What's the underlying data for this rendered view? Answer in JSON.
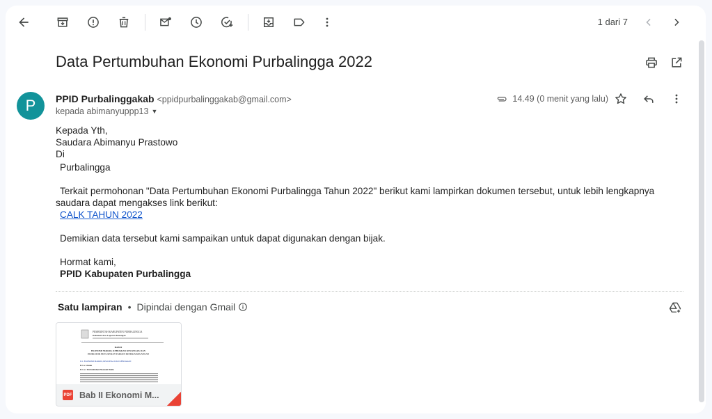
{
  "toolbar": {
    "icons": [
      "back-arrow-icon",
      "archive-icon",
      "report-spam-icon",
      "delete-icon",
      "mark-unread-icon",
      "snooze-icon",
      "add-to-tasks-icon",
      "move-to-icon",
      "label-icon",
      "more-vert-icon"
    ],
    "pager": "1 dari 7"
  },
  "email": {
    "subject": "Data Pertumbuhan Ekonomi Purbalingga 2022",
    "sender_name": "PPID Purbalinggakab",
    "sender_email": "<ppidpurbalinggakab@gmail.com>",
    "to": "kepada abimanyuppp13",
    "avatar_letter": "P",
    "avatar_color": "#12939a",
    "time": "14.49 (0 menit yang lalu)",
    "body": {
      "greeting": "Kepada Yth,",
      "recipient": "Saudara Abimanyu Prastowo",
      "di": "Di",
      "place": "Purbalingga",
      "paragraph": "Terkait permohonan \"Data Pertumbuhan Ekonomi Purbalingga Tahun 2022\" berikut kami lampirkan dokumen tersebut, untuk lebih lengkapnya saudara dapat mengakses link berikut:",
      "link": "CALK TAHUN 2022",
      "closing": "Demikian data tersebut kami sampaikan untuk dapat digunakan dengan bijak.",
      "regards": "Hormat kami,",
      "signature": "PPID Kabupaten Purbalingga"
    }
  },
  "attachments": {
    "title": "Satu lampiran",
    "scan_note": "Dipindai dengan Gmail",
    "file_name": "Bab II Ekonomi M...",
    "pdf_label": "PDF",
    "thumb_text": {
      "line1": "PEMERINTAH KABUPATEN PURBALINGGA",
      "line2": "Dokumen Atas Laporan Keuangan",
      "chapter": "BAB II",
      "heading1": "EKONOMI MAKRO, KEBIJAKAN KEUANGAN, DAN",
      "heading2": "INDIKATOR PENCAPAIAN TARGET KINERJA KEUANGAN",
      "section": "II.1. EKONOMI MAKRO, REGIONAL DAN KEBIJAKAN",
      "sub1": "II.1.a. Umum",
      "sub2": "II.1.a.1 Pertumbuhan Ekonomi Dunia"
    }
  },
  "colors": {
    "accent": "#12939a",
    "link": "#1155cc",
    "pdf": "#ea4335"
  }
}
